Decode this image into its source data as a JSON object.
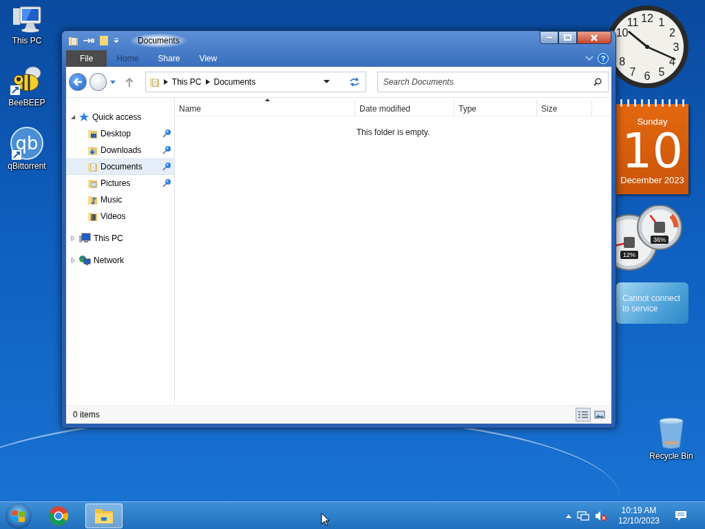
{
  "desktop_icons": [
    {
      "label": "This PC",
      "kind": "computer"
    },
    {
      "label": "BeeBEEP",
      "kind": "bee"
    },
    {
      "label": "qBittorrent",
      "kind": "qb",
      "logo_text": "qb"
    },
    {
      "label": "Recycle Bin",
      "kind": "bin"
    }
  ],
  "explorer": {
    "title": "Documents",
    "ribbon_tabs": [
      {
        "label": "File",
        "kind": "file",
        "dimmed": false
      },
      {
        "label": "Home",
        "kind": "tab",
        "dimmed": true
      },
      {
        "label": "Share",
        "kind": "tab",
        "dimmed": false
      },
      {
        "label": "View",
        "kind": "tab",
        "dimmed": false
      }
    ],
    "help": "?",
    "address": {
      "crumbs": [
        "This PC",
        "Documents"
      ]
    },
    "search": {
      "placeholder": "Search Documents"
    },
    "nav": [
      {
        "label": "Quick access",
        "kind": "star",
        "expanded": true,
        "selected": false,
        "children": [
          {
            "label": "Desktop",
            "kind": "desktop",
            "pinned": true,
            "selected": false
          },
          {
            "label": "Downloads",
            "kind": "downloads",
            "pinned": true,
            "selected": false
          },
          {
            "label": "Documents",
            "kind": "documents",
            "pinned": true,
            "selected": true
          },
          {
            "label": "Pictures",
            "kind": "pictures",
            "pinned": true,
            "selected": false
          },
          {
            "label": "Music",
            "kind": "music",
            "pinned": false,
            "selected": false
          },
          {
            "label": "Videos",
            "kind": "videos",
            "pinned": false,
            "selected": false
          }
        ]
      },
      {
        "label": "This PC",
        "kind": "pc",
        "expanded": false,
        "selected": false
      },
      {
        "label": "Network",
        "kind": "network",
        "expanded": false,
        "selected": false
      }
    ],
    "columns": [
      {
        "label": "Name",
        "sorted": true
      },
      {
        "label": "Date modified",
        "sorted": false
      },
      {
        "label": "Type",
        "sorted": false
      },
      {
        "label": "Size",
        "sorted": false
      }
    ],
    "empty_message": "This folder is empty.",
    "status": "0 items",
    "views": [
      {
        "kind": "details",
        "selected": true
      },
      {
        "kind": "large_icons",
        "selected": false
      }
    ]
  },
  "clock": {
    "numerals": [
      "12",
      "1",
      "2",
      "3",
      "4",
      "5",
      "6",
      "7",
      "8",
      "10",
      "11"
    ]
  },
  "calendar": {
    "weekday": "Sunday",
    "day": "10",
    "month_year": "December 2023"
  },
  "cpu_meter": {
    "gauges": [
      {
        "reading": "12%",
        "level": 0.12
      },
      {
        "reading": "36%",
        "level": 0.36
      }
    ]
  },
  "weather": {
    "message": "Cannot connect to service"
  },
  "taskbar": {
    "apps": [
      {
        "kind": "chrome",
        "selected": false
      },
      {
        "kind": "explorer",
        "selected": true
      }
    ],
    "tray": {
      "time": "10:19 AM",
      "date": "12/10/2023",
      "muted": true
    }
  }
}
